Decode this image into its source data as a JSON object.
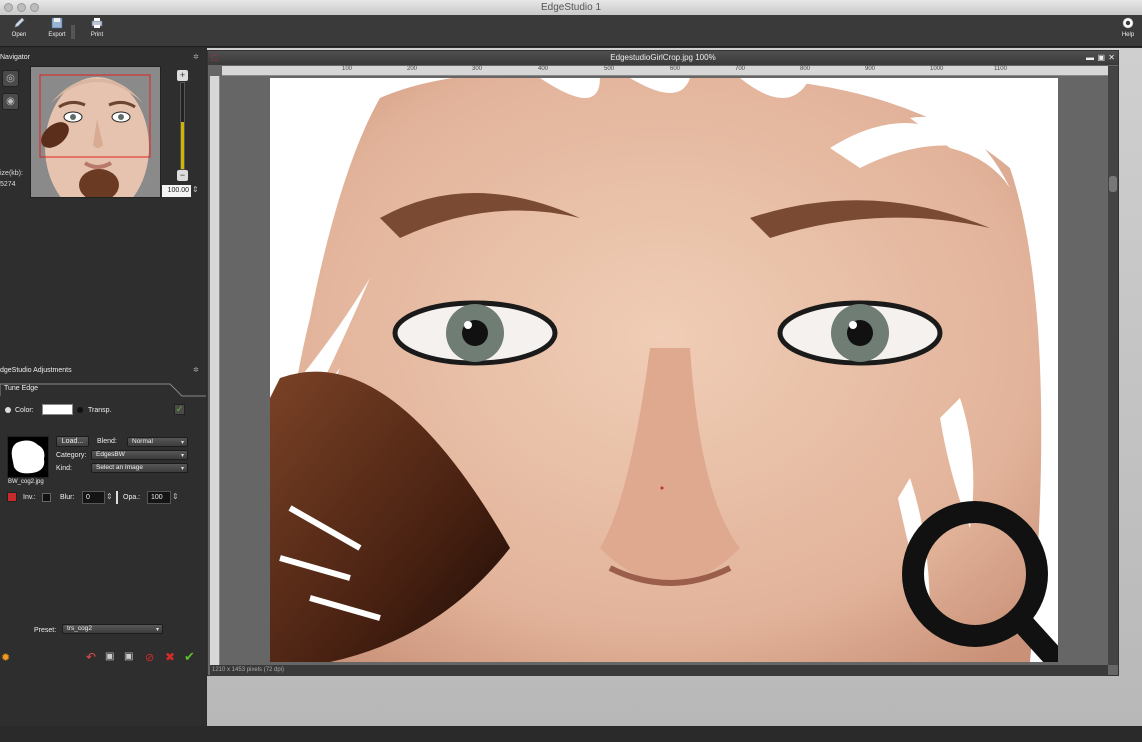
{
  "window": {
    "title": "EdgeStudio 1"
  },
  "toolbar": {
    "open_label": "Open",
    "export_label": "Export",
    "print_label": "Print",
    "help_label": "Help"
  },
  "navigator": {
    "title": "Navigator",
    "zoom_value": "100.00",
    "zoom_level": 0.55,
    "size_label": "ize(kb):",
    "size_value": "5274"
  },
  "adjustments": {
    "title": "dgeStudio Adjustments",
    "tab_label": "Tune Edge",
    "color_label": "Color:",
    "transp_label": "Transp.",
    "load_button": "Load...",
    "blend_label": "Blend:",
    "blend_value": "Normal",
    "category_label": "Category:",
    "category_value": "EdgesBW",
    "kind_label": "Kind:",
    "kind_value": "Select an Image",
    "file_name": "BW_cog2.jpg",
    "inv_label": "Inv.:",
    "blur_label": "Blur:",
    "blur_value": "0",
    "opa_label": "Opa.:",
    "opa_value": "100",
    "preset_label": "Preset:",
    "preset_value": "trs_cog2"
  },
  "document": {
    "title": "EdgestudioGirlCrop.jpg 100%",
    "status": "1210 x 1453 pixels (72 dpi)",
    "ruler_ticks": [
      "100",
      "200",
      "300",
      "400",
      "500",
      "600",
      "700",
      "800",
      "900",
      "1000",
      "1100"
    ]
  },
  "colors": {
    "accent_yellow": "#d0b400",
    "skin": "#e8c2aa",
    "brow": "#7a4a33",
    "brush": "#5b2f1c",
    "ok_green": "#5bbf2a",
    "cancel_red": "#d42a2a"
  }
}
